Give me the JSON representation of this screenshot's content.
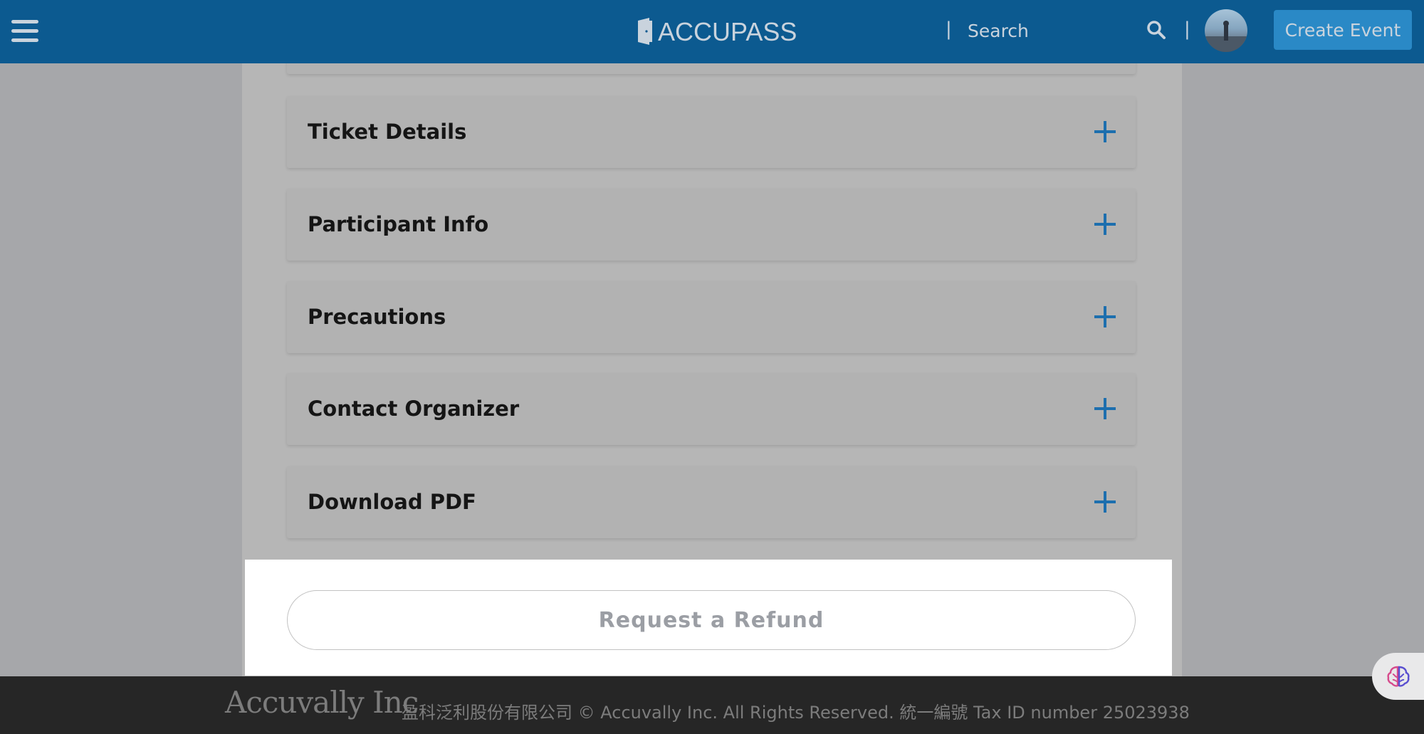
{
  "nav": {
    "brand": "ACCUPASS",
    "search_placeholder": "Search",
    "create_event_label": "Create Event",
    "separator": "|"
  },
  "accordion": [
    {
      "label": "Ticket Details"
    },
    {
      "label": "Participant Info"
    },
    {
      "label": "Precautions"
    },
    {
      "label": "Contact Organizer"
    },
    {
      "label": "Download PDF"
    }
  ],
  "refund": {
    "label": "Request a Refund"
  },
  "footer": {
    "logo": "Accuvally Inc",
    "text": "盈科泛利股份有限公司 © Accuvally Inc. All Rights Reserved. 統一編號 Tax ID number 25023938"
  },
  "colors": {
    "nav_bg": "#0c5a90",
    "create_button": "#2a89c6",
    "plus_icon": "#1d6fae",
    "footer_bg": "#262626"
  },
  "icons": {
    "menu": "hamburger-icon",
    "search": "search-icon",
    "expand": "plus-icon",
    "assistant": "brain-icon"
  }
}
